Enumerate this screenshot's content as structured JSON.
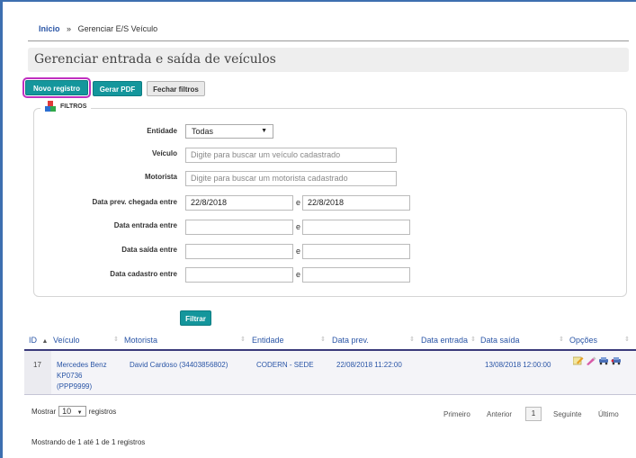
{
  "breadcrumb": {
    "home": "Inicio",
    "separator": "»",
    "current": "Gerenciar E/S Veículo"
  },
  "page_title": "Gerenciar entrada e saída de veículos",
  "toolbar": {
    "new_label": "Novo registro",
    "pdf_label": "Gerar PDF",
    "close_filters_label": "Fechar filtros"
  },
  "filters": {
    "legend": "FILTROS",
    "entidade_label": "Entidade",
    "entidade_value": "Todas",
    "veiculo_label": "Veículo",
    "veiculo_placeholder": "Digite para buscar um veículo cadastrado",
    "motorista_label": "Motorista",
    "motorista_placeholder": "Digite para buscar um motorista cadastrado",
    "prev_chegada_label": "Data prev. chegada entre",
    "prev_chegada_from": "22/8/2018",
    "prev_chegada_to": "22/8/2018",
    "entrada_label": "Data entrada entre",
    "saida_label": "Data saída entre",
    "cadastro_label": "Data cadastro entre",
    "between_word": "e",
    "submit_label": "Filtrar"
  },
  "table": {
    "headers": [
      "ID",
      "Veículo",
      "Motorista",
      "Entidade",
      "Data prev.",
      "Data entrada",
      "Data saída",
      "Opções"
    ],
    "sort_up": "▲",
    "sort_both": "⇕",
    "rows": [
      {
        "id": "17",
        "veiculo_line1": "Mercedes Benz",
        "veiculo_line2": "KP0736",
        "veiculo_line3": "(PPP9999)",
        "motorista": "David Cardoso (34403856802)",
        "entidade": "CODERN - SEDE",
        "data_prev": "22/08/2018 11:22:00",
        "data_entrada": "",
        "data_saida": "13/08/2018 12:00:00"
      }
    ]
  },
  "length_menu": {
    "prefix": "Mostrar",
    "value": "10",
    "suffix": "registros"
  },
  "pagination": {
    "first": "Primeiro",
    "previous": "Anterior",
    "current": "1",
    "next": "Seguinte",
    "last": "Último"
  },
  "info": "Mostrando de 1 até 1 de 1 registros",
  "colors": {
    "teal": "#14969c",
    "link": "#2a55a6",
    "highlight": "#c02fc0"
  }
}
